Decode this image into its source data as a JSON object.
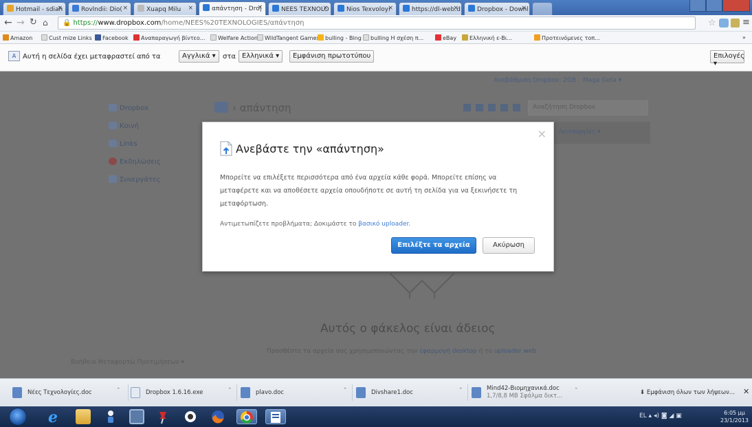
{
  "browser": {
    "tabs": [
      {
        "label": "Hotmail - sdiah",
        "color": "#e8a52b"
      },
      {
        "label": "Rovlndii: Dio(",
        "color": "#3b7ad6"
      },
      {
        "label": "Xuapq Milu",
        "color": "#bbb"
      },
      {
        "label": "απάντηση - Dro|",
        "color": "#2b78d6"
      },
      {
        "label": "NEES TEXNOLO",
        "color": "#2b78d6"
      },
      {
        "label": "Nios Texvoloyi",
        "color": "#2b78d6"
      },
      {
        "label": "https://dl-web.d",
        "color": "#2b78d6"
      },
      {
        "label": "Dropbox - Downl",
        "color": "#2b78d6"
      }
    ],
    "url_scheme": "https://",
    "url_domain": "www.dropbox.com",
    "url_path": "/home/NEES%20TEXNOLOGIES/απάντηση"
  },
  "bookmarks": [
    {
      "label": "Amazon",
      "color": "#e08a1e"
    },
    {
      "label": "Cust  mize Links",
      "color": "#ddd"
    },
    {
      "label": "Facebook",
      "color": "#3b5998"
    },
    {
      "label": "Αναπαραγωγή βίντεο...",
      "color": "#d33"
    },
    {
      "label": "Welfare Action",
      "color": "#ddd"
    },
    {
      "label": "WildTangent Games",
      "color": "#ddd"
    },
    {
      "label": "bulling - Bing",
      "color": "#f4b41a"
    },
    {
      "label": "bulling Η σχέση π...",
      "color": "#ddd"
    },
    {
      "label": "eBay",
      "color": "#e53238"
    },
    {
      "label": "Ελληνική ε-Βι...",
      "color": "#c8a838"
    },
    {
      "label": "Προτεινόμενες τοπ...",
      "color": "#f0a020"
    }
  ],
  "translate_bar": {
    "icon": "A",
    "text": "Αυτή η σελίδα έχει μεταφραστεί από τα",
    "from_lang": "Αγγλικά ▾",
    "middle_word": "στα",
    "to_lang": "Ελληνικά ▾",
    "show_original": "Εμφάνιση πρωτοτύπου",
    "options": "Επιλογές ▾"
  },
  "page": {
    "top_link_1": "Αναβάθμιση Dropbox: 2GB",
    "top_link_2": "Maga Geta ▾",
    "sidebar": [
      {
        "label": "Dropbox"
      },
      {
        "label": "Κοινή"
      },
      {
        "label": "Links"
      },
      {
        "label": "Εκδηλώσεις"
      },
      {
        "label": "Συνεργάτες"
      }
    ],
    "breadcrumb_sep": "›",
    "breadcrumb": "απάντηση",
    "search_placeholder": "Αναζήτηση Dropbox",
    "row_link": "Λειτουργίες ▾",
    "empty_title": "Αυτός ο φάκελος είναι άδειος",
    "empty_sub_text": "Προσθέστε τα αρχεία σας χρησιμοποιώντας την",
    "empty_sub_link1": "εφαρμογή desktop",
    "empty_sub_mid": "ή το",
    "empty_sub_link2": "uploader web",
    "footer_lang": "Βοήθεια Μεταφορτώ Προτιμήσεων ▾"
  },
  "modal": {
    "title": "Ανεβάστε την «απάντηση»",
    "body": "Μπορείτε να επιλέξετε περισσότερα από ένα αρχεία κάθε φορά. Μπορείτε επίσης να μεταφέρετε και να αποθέσετε αρχεία οπουδήποτε σε αυτή τη σελίδα για να ξεκινήσετε τη μεταφόρτωση.",
    "hint_text": "Αντιμετωπίζετε προβλήματα; Δοκιμάστε το",
    "hint_link": "βασικό uploader",
    "hint_end": ".",
    "choose_label": "Επιλέξτε τα αρχεία",
    "cancel_label": "Ακύρωση",
    "close_glyph": "×"
  },
  "downloads": [
    {
      "name": "Νέες Τεχνολογίες.doc"
    },
    {
      "name": "Dropbox 1.6.16.exe"
    },
    {
      "name": "plavo.doc"
    },
    {
      "name": "Divshare1.doc"
    },
    {
      "name_line1": "Mind42-Βιομηχανικά.doc",
      "name_line2": "1,7/8,8 MB Σφάλμα δικτ..."
    }
  ],
  "download_shelf": {
    "show_all": "⬇ Εμφάνιση όλων των λήψεων...",
    "close": "✕"
  },
  "taskbar": {
    "tray_text": "EL ▴ ◂) ◙ ◢ ▣",
    "time": "6:05 μμ",
    "date": "23/1/2013"
  }
}
